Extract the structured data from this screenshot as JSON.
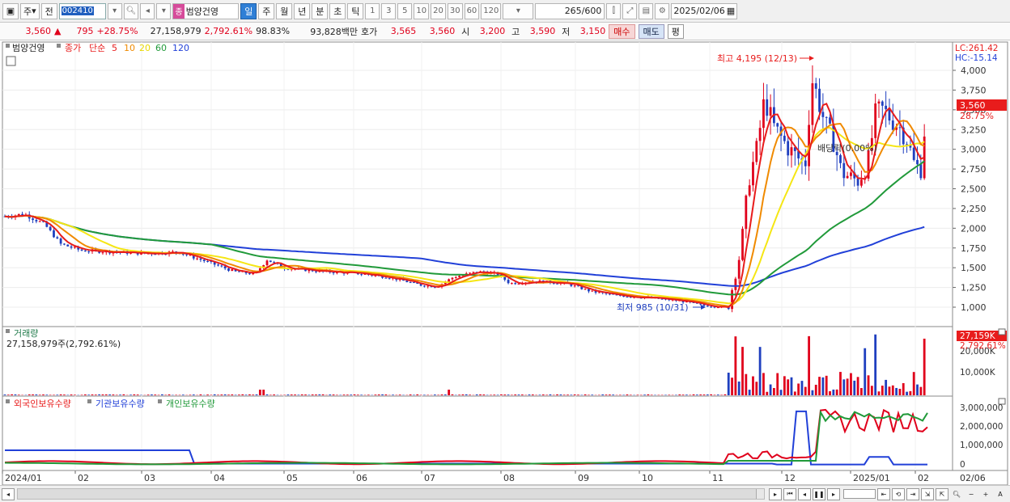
{
  "toolbar": {
    "period_label": "주",
    "prev_label": "전",
    "stock_code": "002410",
    "stock_tag": "종",
    "stock_name": "범양건영",
    "periods": [
      "일",
      "주",
      "월",
      "년",
      "분",
      "초",
      "틱"
    ],
    "active_period": "일",
    "intervals": [
      "1",
      "3",
      "5",
      "10",
      "20",
      "30",
      "60",
      "120"
    ],
    "count": "265",
    "count_total": "/600",
    "date": "2025/02/06"
  },
  "info": {
    "price": "3,560",
    "change_arrow": "▲",
    "change": "795",
    "change_pct": "+28.75%",
    "volume": "27,158,979",
    "volume_pct": "2,792.61%",
    "ratio": "98.83%",
    "trade_value": "93,828백만",
    "ask_label": "호가",
    "ask_price": "3,565",
    "bid_price": "3,560",
    "open_label": "시",
    "open": "3,200",
    "high_label": "고",
    "high": "3,590",
    "low_label": "저",
    "low": "3,150",
    "buy_label": "매수",
    "sell_label": "매도",
    "eval_label": "평"
  },
  "legend": {
    "stock_name": "범양건영",
    "price_label": "종가",
    "ma_label": "단순",
    "ma_periods": [
      "5",
      "10",
      "20",
      "60",
      "120"
    ],
    "lc": "LC:261.42",
    "hc": "HC:-15.14"
  },
  "annotations": {
    "high": "최고 4,195 (12/13)",
    "low": "최저 985 (10/31)",
    "allocation": "배당락(0.00%)"
  },
  "colors": {
    "ma5": "#e81c1c",
    "ma10": "#f08a00",
    "ma20": "#f5e614",
    "ma60": "#219a3a",
    "ma120": "#2140d8",
    "up": "#e0001b",
    "down": "#1f3fbf"
  },
  "volume_panel": {
    "title": "거래량",
    "value_label": "27,158,979주(2,792.61%)",
    "current_value": "27,159K",
    "current_pct": "2,792.61%",
    "axis_ticks": [
      "20,000K",
      "10,000K"
    ]
  },
  "holdings_panel": {
    "series": [
      "외국인보유수량",
      "기관보유수량",
      "개인보유수량"
    ],
    "axis_ticks": [
      "3,000,000",
      "2,000,000",
      "1,000,000",
      "0"
    ]
  },
  "price_axis": {
    "ticks": [
      "4,000",
      "3,750",
      "3,500",
      "3,250",
      "3,000",
      "2,750",
      "2,500",
      "2,250",
      "2,000",
      "1,750",
      "1,500",
      "1,250",
      "1,000"
    ],
    "current_price": "3,560",
    "current_pct": "28.75%"
  },
  "x_axis": {
    "labels": [
      "2024/01",
      "02",
      "03",
      "04",
      "05",
      "06",
      "07",
      "08",
      "09",
      "10",
      "11",
      "12",
      "2025/01",
      "02"
    ],
    "right_label": "02/06"
  },
  "chart_data": {
    "type": "candlestick",
    "title": "범양건영",
    "x_range": [
      "2024/01",
      "2025/02/06"
    ],
    "ylim": [
      850,
      4250
    ],
    "series": [
      {
        "name": "5",
        "type": "line"
      },
      {
        "name": "10",
        "type": "line"
      },
      {
        "name": "20",
        "type": "line"
      },
      {
        "name": "60",
        "type": "line"
      },
      {
        "name": "120",
        "type": "line"
      }
    ],
    "annotations": [
      {
        "text": "최고 4,195 (12/13)",
        "date": "2024/12/13",
        "value": 4195
      },
      {
        "text": "최저 985 (10/31)",
        "date": "2024/10/31",
        "value": 985
      }
    ],
    "last": {
      "date": "2025/02/06",
      "close": 3560,
      "open": 3200,
      "high": 3590,
      "low": 3150
    }
  }
}
